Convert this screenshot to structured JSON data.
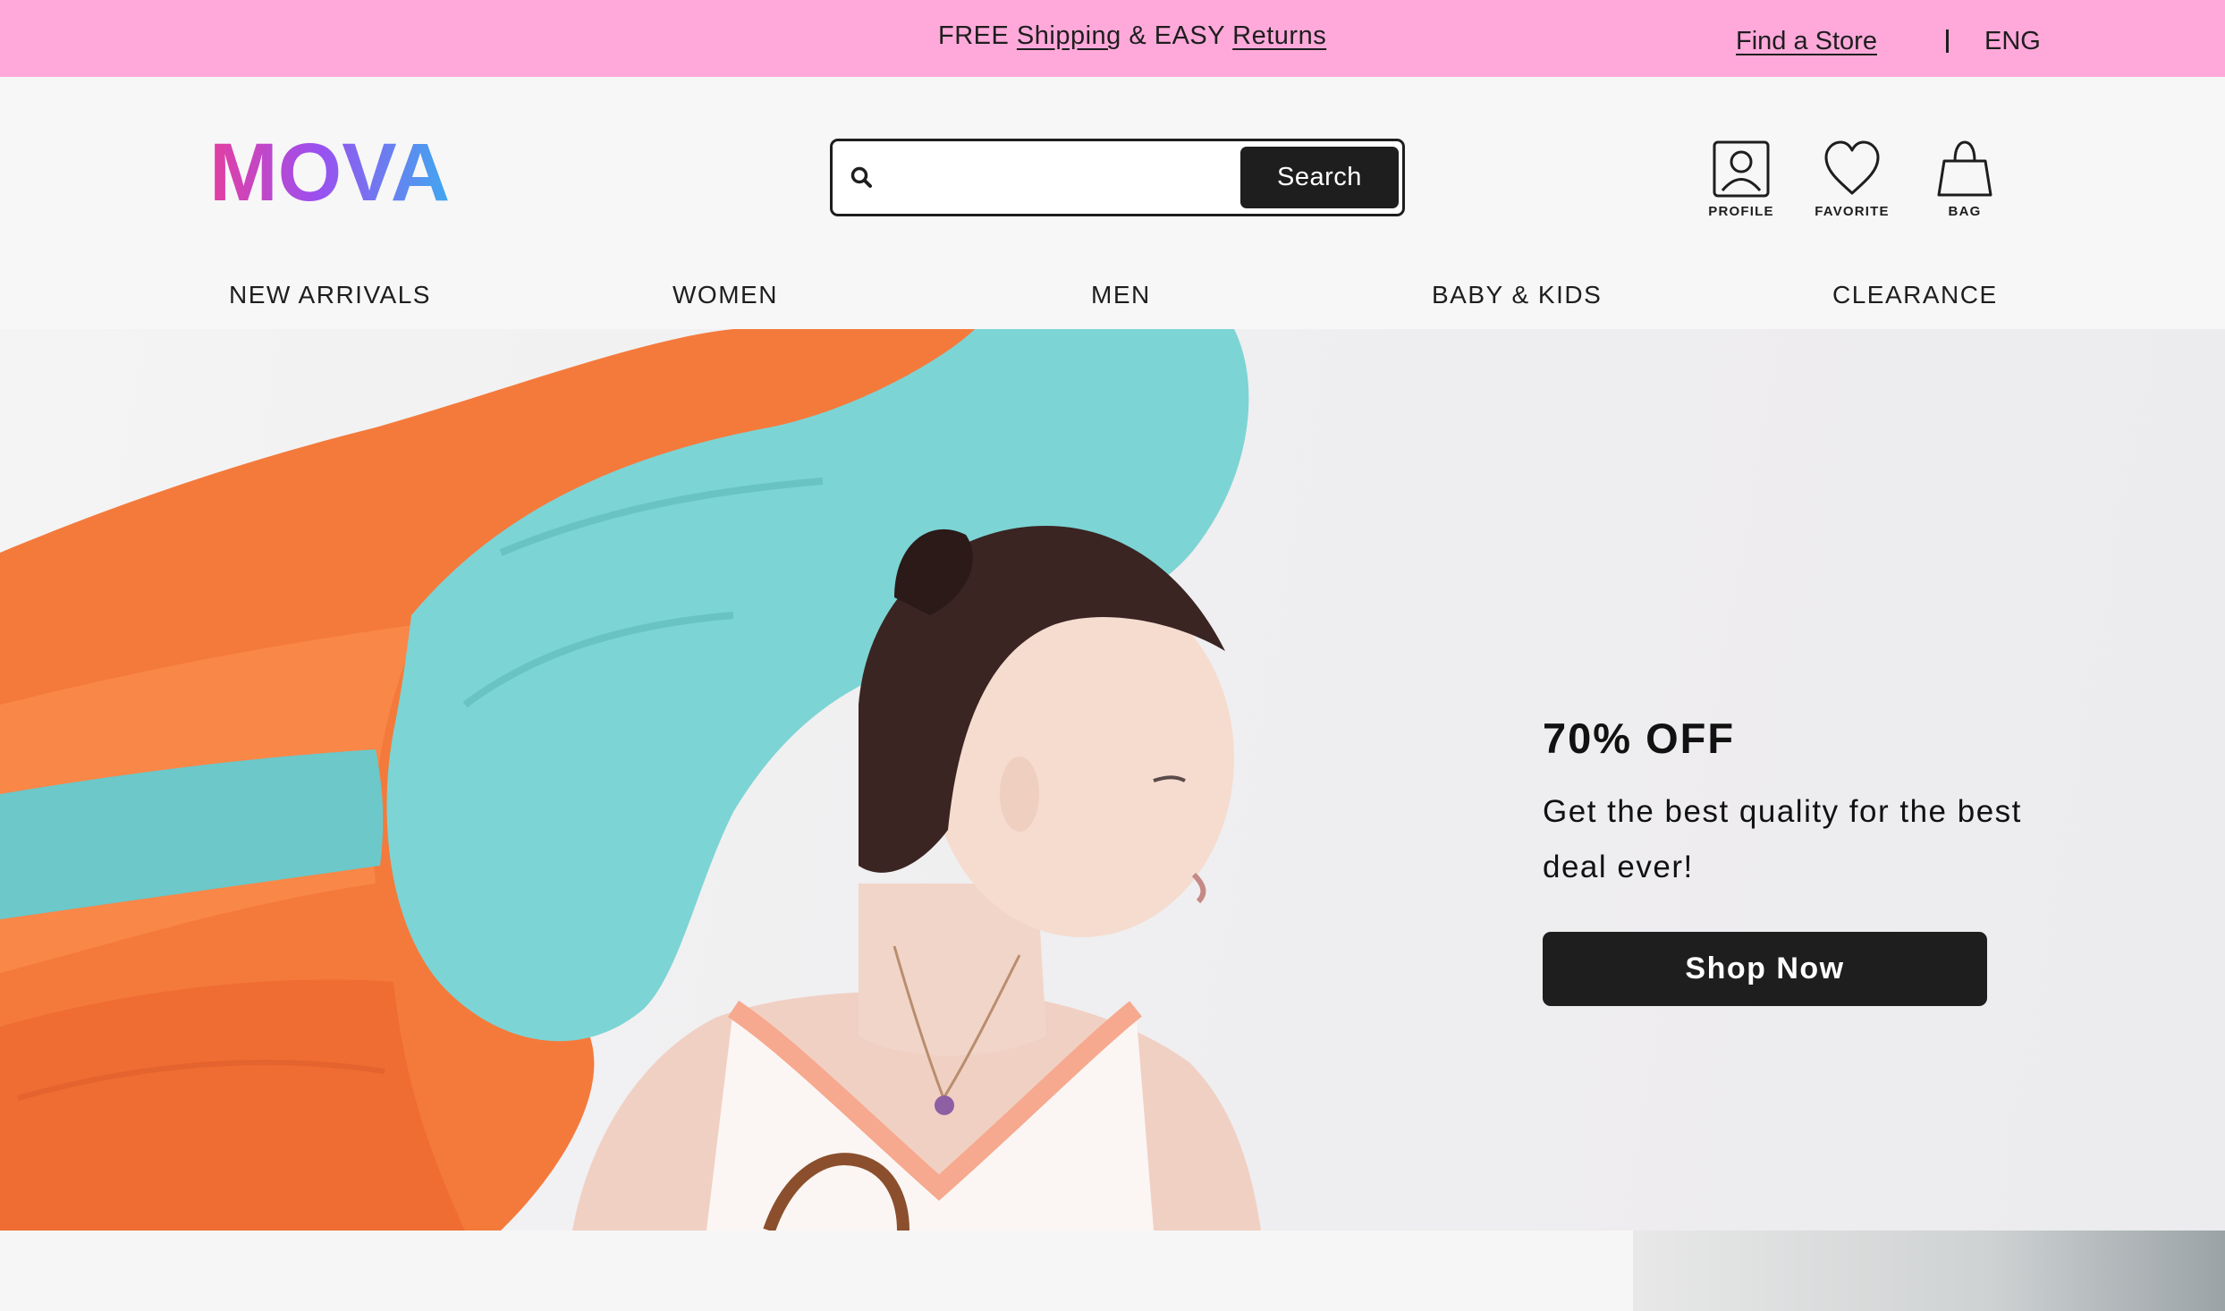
{
  "promo": {
    "free": "FREE ",
    "shipping_link": "Shipping",
    "and_easy": " & EASY ",
    "returns_link": "Returns",
    "find_store": "Find a Store",
    "language": "ENG"
  },
  "header": {
    "logo_text": "MOVA",
    "search": {
      "placeholder": "",
      "value": "",
      "button_label": "Search"
    },
    "icons": {
      "profile_label": "PROFILE",
      "favorite_label": "FAVORITE",
      "bag_label": "BAG"
    }
  },
  "nav": {
    "items": [
      {
        "label": "NEW ARRIVALS"
      },
      {
        "label": "WOMEN"
      },
      {
        "label": "MEN"
      },
      {
        "label": "BABY & KIDS"
      },
      {
        "label": "CLEARANCE"
      }
    ]
  },
  "hero": {
    "title": "70% OFF",
    "subtitle": "Get the best quality for the best deal ever!",
    "cta": "Shop Now",
    "image_icon": "model-with-fabric-image"
  },
  "colors": {
    "promo_bg": "#ffa9da",
    "dark": "#1e1e1e",
    "logo_gradient": [
      "#e53fa0",
      "#9b4ff0",
      "#3fa8f0"
    ]
  }
}
